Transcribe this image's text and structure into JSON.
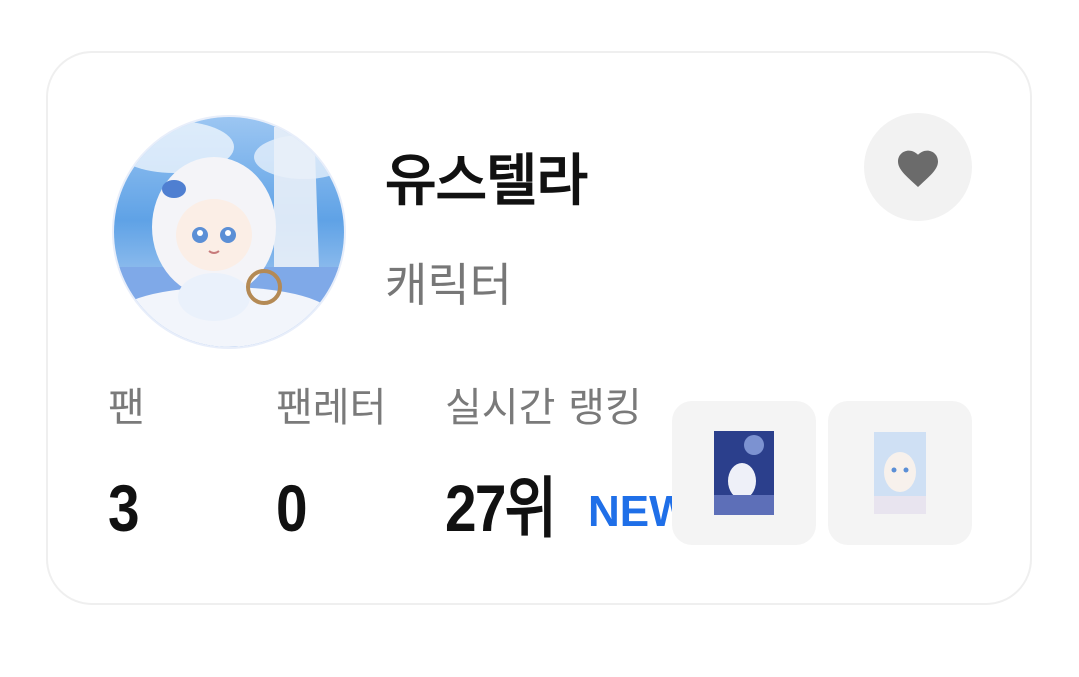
{
  "profile": {
    "name": "유스텔라",
    "category": "캐릭터",
    "avatar_icon": "character-avatar"
  },
  "like_button": {
    "icon": "heart-icon",
    "color": "#6b6b6b"
  },
  "stats": {
    "fans": {
      "label": "팬",
      "value": "3"
    },
    "fan_letters": {
      "label": "팬레터",
      "value": "0"
    },
    "ranking": {
      "label": "실시간 랭킹",
      "value": "27위",
      "badge": "NEW"
    }
  },
  "colors": {
    "accent": "#1f6fe8",
    "text_primary": "#111111",
    "text_secondary": "#7a7a7a",
    "tile_background": "#f4f4f4"
  }
}
